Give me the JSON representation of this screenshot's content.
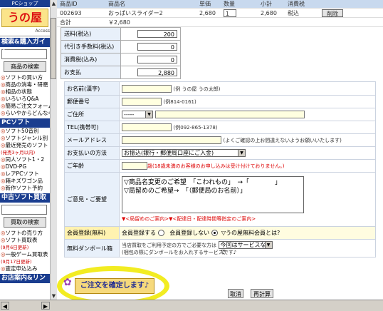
{
  "sidebar": {
    "logo_top": "PCショップ",
    "logo_brand": "うの屋",
    "logo_sub": "Access",
    "section1": "検索&購入ガイド",
    "search_button": "商品の検索",
    "items1": [
      "ソフトの買い方",
      "商品の消毒・研磨",
      "相品の状態",
      "いろいろQ&A",
      "簡易ご注文フォーム",
      "らいやからどんなキー(新)でご"
    ],
    "section2": "PCソフトINDEX",
    "items2": [
      "ソフト50音別",
      "ソフトジャンル別",
      "最近発売のソフト",
      "(発売3ヶ月以内)",
      "同人ソフト1・2",
      "DVD-PG",
      "レアPCソフト",
      "箱キズワゴン品",
      "新作ソフト予約"
    ],
    "section3": "中古ソフト買取",
    "buy_button": "買取の検索",
    "items3": [
      "ソフトの売り方",
      "ソフト買取表",
      "(9月6日更新)",
      "一般ゲーム買取表",
      "(9月17日更新)",
      "査定申込込み"
    ],
    "section4": "お店案内&リンク"
  },
  "cart": {
    "header": [
      "商品ID",
      "商品名",
      "単価",
      "数量",
      "小計",
      "消費税",
      ""
    ],
    "row": {
      "id": "002693",
      "name": "おっぱいスライダー2",
      "price": "2,680",
      "qty": "1",
      "subtotal": "2,680",
      "tax": "税込",
      "delete": "削除"
    },
    "total_label": "合計",
    "total_value": "￥2,680"
  },
  "summary": [
    {
      "label": "送料(税込)",
      "value": "200"
    },
    {
      "label": "代引き手数料(税込)",
      "value": "0"
    },
    {
      "label": "消費税(込み)",
      "value": "0"
    },
    {
      "label": "お支払",
      "value": "2,880"
    }
  ],
  "form": {
    "name_label": "お名前(漢字)",
    "name_note": "(例 うの屋 うの太郎)",
    "zip_label": "郵便番号",
    "zip_note": "(例814-0161)",
    "address_label": "ご住所",
    "pref_value": "-----",
    "tel_label": "TEL(携帯可)",
    "tel_note": "(例092-865-1378)",
    "mail_label": "メールアドレス",
    "mail_note": "(よくご確認の上お間違えないようお願いいたします)",
    "pay_label": "お支払いの方法",
    "pay_value": "お振込(銀行・郵便局口座にご入金)",
    "age_label": "ご年齢",
    "age_note": "歳(18歳未満のお客様のお申し込みは受け付けておりません。)",
    "request_label": "ご意見・ご要望",
    "request_text": "▽商品名変更のご希望　「こわれもの」　→「　　　　」\n▽局留めのご希望→　「（郵便局のお名前）」",
    "request_links": "▼<局留めのご案内>▼<配達日・配達時間等指定のご案内>",
    "member_label": "会員登録(無料)",
    "member_opt1": "会員登録する",
    "member_opt2": "会員登録しない",
    "member_help": "うの屋無料会員とは?",
    "cardboard_label": "無料ダンボール箱",
    "cardboard_text": "当店買取をご利用予定の方でご必要な方は",
    "cardboard_value": "今回はサービスなしで",
    "cardboard_note": "(梱包の際にダンボールをお入れするサービスです♪"
  },
  "confirm_label": "ご注文を確定します♪",
  "recalc_label": "再計算",
  "cancel_label": "取消"
}
